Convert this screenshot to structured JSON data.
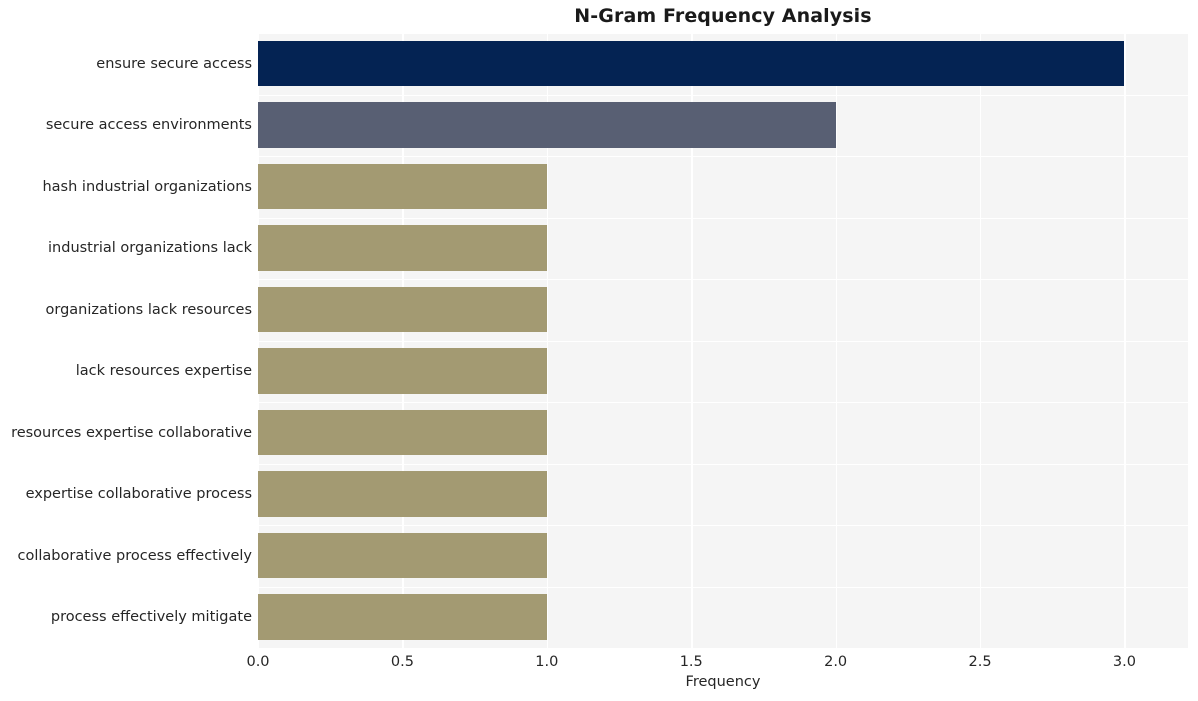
{
  "chart_data": {
    "type": "bar",
    "orientation": "horizontal",
    "title": "N-Gram Frequency Analysis",
    "xlabel": "Frequency",
    "ylabel": "",
    "xlim": [
      0,
      3.22
    ],
    "xticks": [
      "0.0",
      "0.5",
      "1.0",
      "1.5",
      "2.0",
      "2.5",
      "3.0"
    ],
    "xtick_values": [
      0,
      0.5,
      1,
      1.5,
      2,
      2.5,
      3
    ],
    "grid": true,
    "legend": "none",
    "categories": [
      "ensure secure access",
      "secure access environments",
      "hash industrial organizations",
      "industrial organizations lack",
      "organizations lack resources",
      "lack resources expertise",
      "resources expertise collaborative",
      "expertise collaborative process",
      "collaborative process effectively",
      "process effectively mitigate"
    ],
    "values": [
      3,
      2,
      1,
      1,
      1,
      1,
      1,
      1,
      1,
      1
    ],
    "bar_colors": [
      "#042353",
      "#585f73",
      "#a39a72",
      "#a39a72",
      "#a39a72",
      "#a39a72",
      "#a39a72",
      "#a39a72",
      "#a39a72",
      "#a39a72"
    ],
    "plot_background": "#f5f5f5",
    "grid_color": "#ffffff",
    "text_color": "#262626"
  }
}
